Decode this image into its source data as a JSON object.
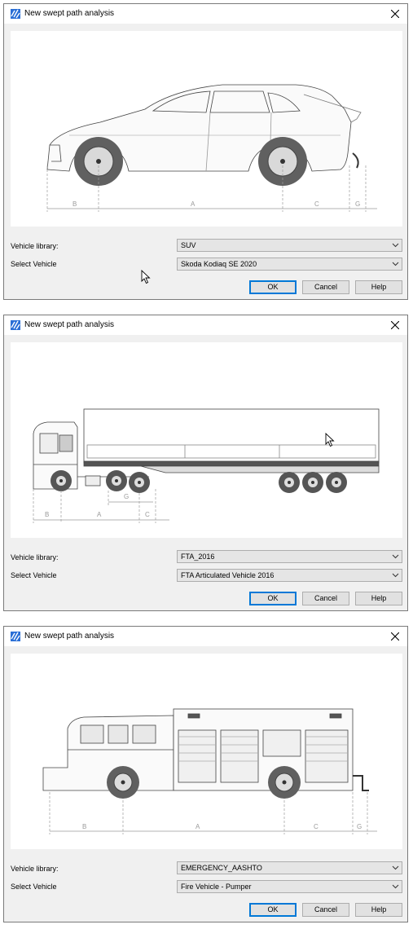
{
  "dialogs": [
    {
      "title": "New swept path analysis",
      "vehicle_library_label": "Vehicle library:",
      "vehicle_library_value": "SUV",
      "select_vehicle_label": "Select Vehicle",
      "select_vehicle_value": "Skoda Kodiaq SE 2020",
      "ok_label": "OK",
      "cancel_label": "Cancel",
      "help_label": "Help",
      "dimension_labels": [
        "B",
        "A",
        "C",
        "G"
      ]
    },
    {
      "title": "New swept path analysis",
      "vehicle_library_label": "Vehicle library:",
      "vehicle_library_value": "FTA_2016",
      "select_vehicle_label": "Select Vehicle",
      "select_vehicle_value": "FTA Articulated Vehicle 2016",
      "ok_label": "OK",
      "cancel_label": "Cancel",
      "help_label": "Help",
      "dimension_labels": [
        "B",
        "A",
        "G",
        "C"
      ]
    },
    {
      "title": "New swept path analysis",
      "vehicle_library_label": "Vehicle library:",
      "vehicle_library_value": "EMERGENCY_AASHTO",
      "select_vehicle_label": "Select Vehicle",
      "select_vehicle_value": "Fire Vehicle - Pumper",
      "ok_label": "OK",
      "cancel_label": "Cancel",
      "help_label": "Help",
      "dimension_labels": [
        "B",
        "A",
        "C",
        "G"
      ]
    }
  ],
  "icons": {
    "app": "swept-path-app-icon",
    "close": "close-icon",
    "dropdown": "chevron-down-icon",
    "cursor": "mouse-pointer-icon"
  },
  "colors": {
    "dialog_bg": "#f0f0f0",
    "default_button_border": "#0078d7",
    "dimension_line": "#9a9a9a"
  }
}
